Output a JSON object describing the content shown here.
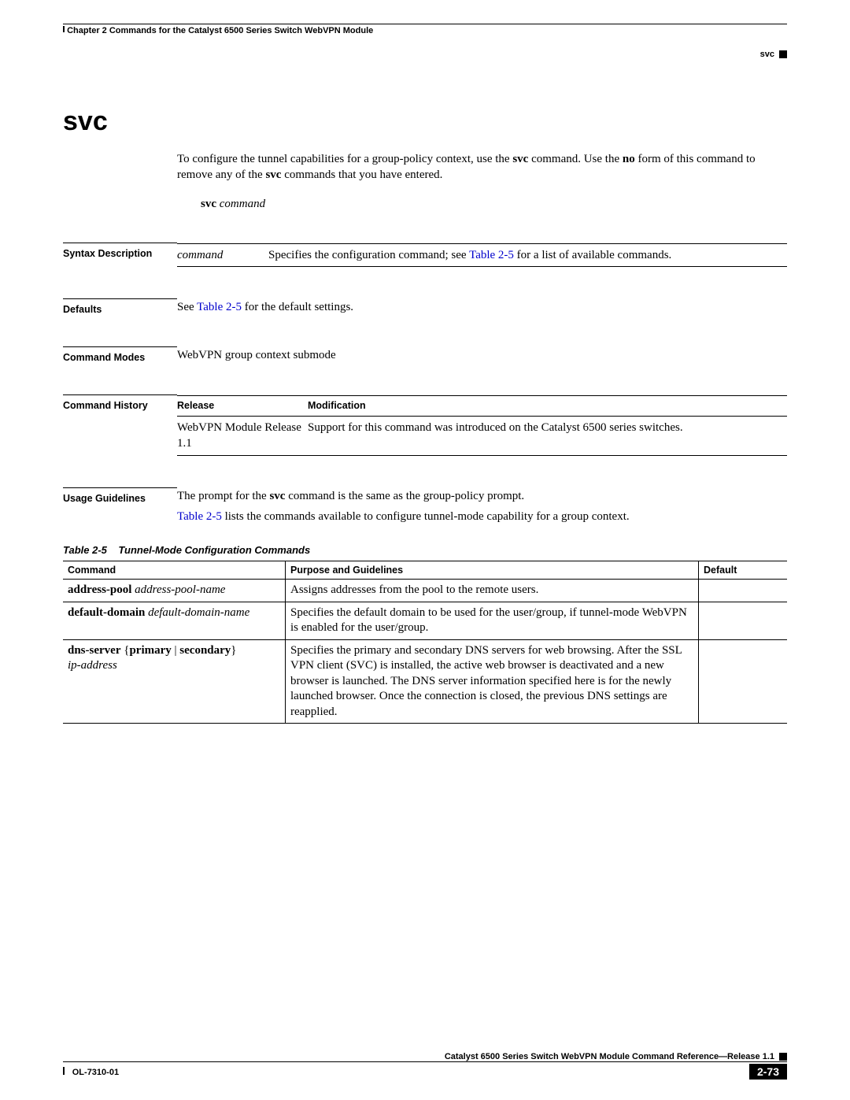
{
  "header": {
    "chapter": "Chapter 2      Commands for the Catalyst 6500 Series Switch WebVPN Module",
    "topic": "svc"
  },
  "title": "svc",
  "intro": {
    "p1_a": "To configure the tunnel capabilities for a group-policy context, use the ",
    "p1_b": "svc",
    "p1_c": " command. Use the ",
    "p1_d": "no",
    "p1_e": " form of this command to remove any of the ",
    "p1_f": "svc",
    "p1_g": " commands that you have entered."
  },
  "syntax_line": {
    "cmd": "svc",
    "arg": "command"
  },
  "labels": {
    "syntax_desc": "Syntax Description",
    "defaults": "Defaults",
    "command_modes": "Command Modes",
    "command_history": "Command History",
    "usage": "Usage Guidelines"
  },
  "syntax_desc": {
    "param": "command",
    "desc_a": "Specifies the configuration command; see ",
    "desc_link": "Table 2-5",
    "desc_b": " for a list of available commands."
  },
  "defaults": {
    "a": "See ",
    "link": "Table 2-5",
    "b": " for the default settings."
  },
  "command_modes": "WebVPN group context submode",
  "history": {
    "h_release": "Release",
    "h_mod": "Modification",
    "release": "WebVPN Module Release 1.1",
    "mod": "Support for this command was introduced on the Catalyst 6500 series switches."
  },
  "usage": {
    "p1_a": "The prompt for the ",
    "p1_b": "svc",
    "p1_c": " command is the same as the group-policy prompt.",
    "p2_link": "Table 2-5",
    "p2_b": " lists the commands available to configure tunnel-mode capability for a group context."
  },
  "table_caption_a": "Table 2-5",
  "table_caption_b": "Tunnel-Mode Configuration Commands",
  "cmd_table": {
    "h_cmd": "Command",
    "h_purpose": "Purpose and Guidelines",
    "h_default": "Default",
    "rows": [
      {
        "cmd_b": "address-pool",
        "cmd_i": "address-pool-name",
        "purpose": "Assigns addresses from the pool to the remote users.",
        "def": ""
      },
      {
        "cmd_b": "default-domain",
        "cmd_i": "default-domain-name",
        "purpose": "Specifies the default domain to be used for the user/group, if tunnel-mode WebVPN is enabled for the user/group.",
        "def": ""
      },
      {
        "cmd_b": "dns-server",
        "cmd_mid": " {",
        "cmd_b2": "primary",
        "cmd_sep": " | ",
        "cmd_b3": "secondary",
        "cmd_end": "}",
        "cmd_i": "ip-address",
        "purpose": "Specifies the primary and secondary DNS servers for web browsing. After the SSL VPN client (SVC) is installed, the active web browser is deactivated and a new browser is launched. The DNS server information specified here is for the newly launched browser. Once the connection is closed, the previous DNS settings are reapplied.",
        "def": ""
      }
    ]
  },
  "footer": {
    "book": "Catalyst 6500 Series Switch WebVPN Module Command Reference—Release 1.1",
    "docnum": "OL-7310-01",
    "page": "2-73"
  }
}
